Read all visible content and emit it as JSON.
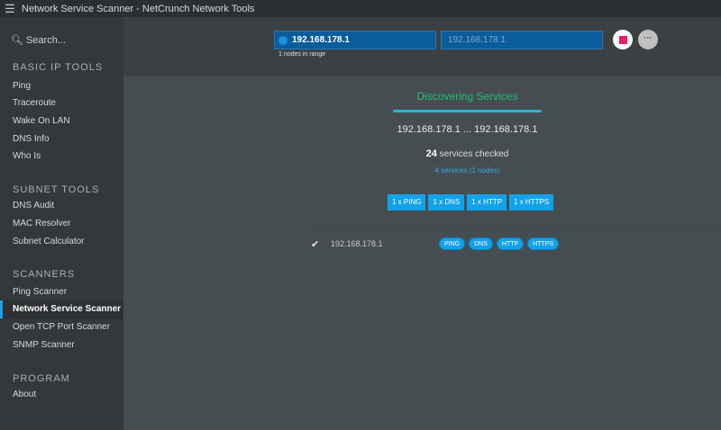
{
  "window": {
    "title": "Network Service Scanner - NetCrunch Network Tools",
    "menu_icon": "hamburger-icon"
  },
  "sidebar": {
    "search_placeholder": "Search...",
    "sections": [
      {
        "title": "BASIC IP TOOLS",
        "items": [
          "Ping",
          "Traceroute",
          "Wake On LAN",
          "DNS Info",
          "Who Is"
        ]
      },
      {
        "title": "SUBNET TOOLS",
        "items": [
          "DNS Audit",
          "MAC Resolver",
          "Subnet Calculator"
        ]
      },
      {
        "title": "SCANNERS",
        "items": [
          "Ping Scanner",
          "Network Service Scanner",
          "Open TCP Port Scanner",
          "SNMP Scanner"
        ]
      },
      {
        "title": "PROGRAM",
        "items": [
          "About"
        ]
      }
    ],
    "active_item": "Network Service Scanner"
  },
  "toolbar": {
    "from_ip": "192.168.178.1",
    "to_ip_placeholder": "192.168.178.1",
    "range_info": "1 nodes in range",
    "more_label": "···"
  },
  "main": {
    "title": "Discovering Services",
    "progress": 1.0,
    "ip_range": "192.168.178.1 ... 192.168.178.1",
    "checked_count": "24",
    "checked_label": "services checked",
    "found": "4 services (1 nodes)",
    "service_counts": [
      "1 x PING",
      "1 x DNS",
      "1 x HTTP",
      "1 x HTTPS"
    ],
    "results": [
      {
        "ip": "192.168.178.1",
        "status": "✔",
        "services": [
          "PING",
          "DNS",
          "HTTP",
          "HTTPS"
        ]
      }
    ]
  },
  "colors": {
    "accent": "#12a2ea",
    "title_green": "#1fbf7a",
    "stop_red": "#e91e63"
  }
}
